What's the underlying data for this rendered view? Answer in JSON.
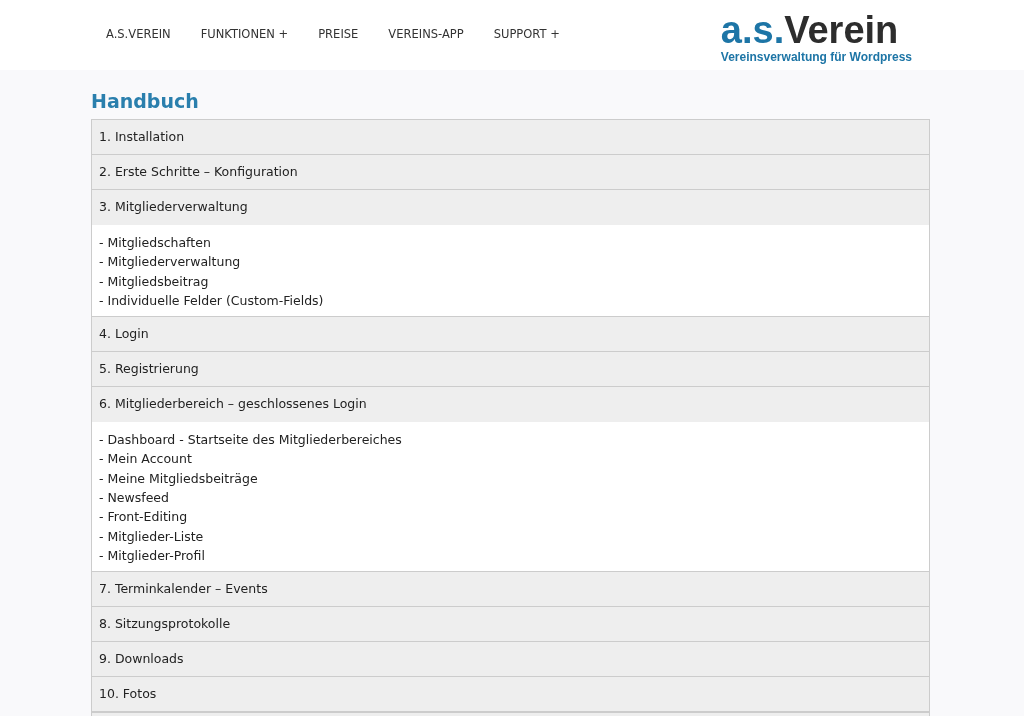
{
  "nav": [
    {
      "label": "A.S.VEREIN"
    },
    {
      "label": "FUNKTIONEN",
      "indicator": "+"
    },
    {
      "label": "PREISE"
    },
    {
      "label": "VEREINS-APP"
    },
    {
      "label": "SUPPORT",
      "indicator": "+"
    }
  ],
  "logo": {
    "prefix": "a.s.",
    "name": "Verein",
    "tagline": "Vereinsverwaltung für Wordpress"
  },
  "title": "Handbuch",
  "sections": [
    {
      "title": "1. Installation",
      "expanded": false
    },
    {
      "title": "2. Erste Schritte – Konfiguration",
      "expanded": false
    },
    {
      "title": "3. Mitgliederverwaltung",
      "expanded": true,
      "entries": [
        "- Mitgliedschaften",
        "- Mitgliederverwaltung",
        "- Mitgliedsbeitrag",
        "- Individuelle Felder (Custom-Fields)"
      ]
    },
    {
      "title": "4. Login",
      "expanded": false
    },
    {
      "title": "5. Registrierung",
      "expanded": false
    },
    {
      "title": "6. Mitgliederbereich – geschlossenes Login",
      "expanded": true,
      "entries": [
        "- Dashboard - Startseite des Mitgliederbereiches",
        "- Mein Account",
        "- Meine Mitgliedsbeiträge",
        "- Newsfeed",
        "- Front-Editing",
        "- Mitglieder-Liste",
        "- Mitglieder-Profil"
      ]
    },
    {
      "title": "7. Terminkalender – Events",
      "expanded": false
    },
    {
      "title": "8. Sitzungsprotokolle",
      "expanded": false
    },
    {
      "title": "9. Downloads",
      "expanded": false
    },
    {
      "title": "10. Fotos",
      "expanded": false
    }
  ]
}
